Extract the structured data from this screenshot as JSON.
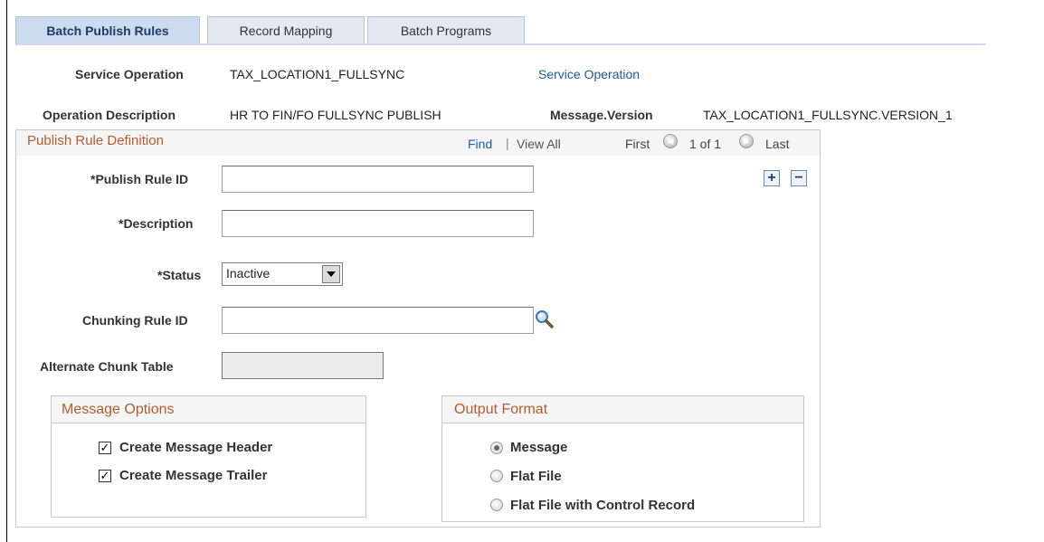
{
  "tabs": [
    {
      "label": "Batch Publish Rules",
      "active": true
    },
    {
      "label": "Record Mapping",
      "active": false
    },
    {
      "label": "Batch Programs",
      "active": false
    }
  ],
  "header": {
    "service_operation_label": "Service Operation",
    "service_operation_value": "TAX_LOCATION1_FULLSYNC",
    "service_operation_link": "Service Operation",
    "operation_description_label": "Operation Description",
    "operation_description_value": "HR TO FIN/FO FULLSYNC PUBLISH",
    "message_version_label": "Message.Version",
    "message_version_value": "TAX_LOCATION1_FULLSYNC.VERSION_1"
  },
  "group": {
    "title": "Publish Rule Definition",
    "find": "Find",
    "separator": "|",
    "view_all": "View All",
    "first": "First",
    "count": "1 of 1",
    "last": "Last",
    "add": "+",
    "remove": "−"
  },
  "fields": {
    "publish_rule_id_label": "*Publish Rule ID",
    "publish_rule_id_value": "",
    "description_label": "*Description",
    "description_value": "",
    "status_label": "*Status",
    "status_value": "Inactive",
    "chunking_rule_id_label": "Chunking Rule ID",
    "chunking_rule_id_value": "",
    "alternate_chunk_table_label": "Alternate Chunk Table",
    "alternate_chunk_table_value": ""
  },
  "message_options": {
    "title": "Message Options",
    "items": [
      {
        "label": "Create Message Header",
        "checked": true
      },
      {
        "label": "Create Message Trailer",
        "checked": true
      }
    ]
  },
  "output_format": {
    "title": "Output Format",
    "items": [
      {
        "label": "Message",
        "selected": true
      },
      {
        "label": "Flat File",
        "selected": false
      },
      {
        "label": "Flat File with Control Record",
        "selected": false
      }
    ]
  },
  "icons": {
    "lookup": "magnifier-icon",
    "prev": "previous-icon",
    "next": "next-icon",
    "dropdown": "chevron-down-icon"
  },
  "colors": {
    "section_title": "#b35d2f",
    "link": "#1d5aa6",
    "active_tab": "#cddbef"
  }
}
